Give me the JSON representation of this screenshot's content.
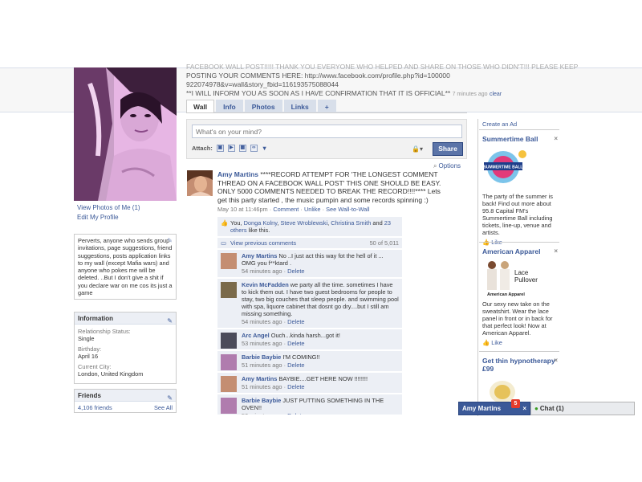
{
  "status": {
    "line1": "FACEBOOK WALL POST!!!!! THANK YOU EVERYONE WHO HELPED AND SHARE ON THOSE WHO DIDN'T!!!   PLEASE KEEP",
    "line2": "POSTING YOUR COMMENTS HERE: http://www.facebook.com/profile.php?id=100000",
    "line3": "922074978&v=wall&story_fbid=116193575088044",
    "line4": "**I WILL INFORM YOU AS SOON AS I HAVE CONFIRMATION THAT IT IS OFFICIAL**",
    "time": "7 minutes ago",
    "clear": "clear"
  },
  "profile": {
    "view_photos": "View Photos of Me (1)",
    "edit_profile": "Edit My Profile",
    "bio": "Perverts, anyone who sends group invitations, page suggestions, friend suggestions, posts application links to my wall (except Mafia wars) and anyone who pokes me will be deleted. ..But I don't give a shit if you declare war on me cos its just a game"
  },
  "info": {
    "title": "Information",
    "rel_label": "Relationship Status:",
    "rel_value": "Single",
    "bday_label": "Birthday:",
    "bday_value": "April 16",
    "city_label": "Current City:",
    "city_value": "London, United Kingdom"
  },
  "friends": {
    "title": "Friends",
    "count": "4,106 friends",
    "see_all": "See All"
  },
  "tabs": [
    "Wall",
    "Info",
    "Photos",
    "Links",
    "+"
  ],
  "composer": {
    "placeholder": "What's on your mind?",
    "attach": "Attach:",
    "share": "Share"
  },
  "options": "Options",
  "post": {
    "author": "Amy Martins",
    "text": " ****RECORD ATTEMPT FOR 'THE LONGEST COMMENT THREAD ON A FACEBOOK WALL POST' THIS ONE SHOULD BE EASY. ONLY 5000 COMMENTS NEEDED TO BREAK THE RECORD!!!!**** Lets get this party started , the music pumpin and some records spinning :)",
    "time": "May 10 at 11:46pm",
    "comment": "Comment",
    "unlike": "Unlike",
    "see_wall": "See Wall-to-Wall",
    "sep": "·"
  },
  "likes": {
    "you": "You,",
    "n1": "Donga Kolny",
    "n2": "Steve Wroblewski",
    "n3": "Christina Smith",
    "and": "and",
    "others": "23 others",
    "tail": "like this."
  },
  "viewprev": {
    "label": "View previous comments",
    "count": "50 of 5,011"
  },
  "comments": [
    {
      "name": "Amy Martins",
      "text": "No ..I just act this way fot the hell of it ... OMG you f**ktard .",
      "time": "54 minutes ago",
      "del": "Delete",
      "color": "#c48e72"
    },
    {
      "name": "Kevin McFadden",
      "text": "we party all the time. sometimes I have to kick them out. I have two guest bedrooms for people to stay, two big couches that sleep people. and swimming pool with spa, liquore cabinet that dosnt go dry....but I still am missing something.",
      "time": "54 minutes ago",
      "del": "Delete",
      "color": "#7a6a4a"
    },
    {
      "name": "Arc Angel",
      "text": "Ouch...kinda harsh...got it!",
      "time": "53 minutes ago",
      "del": "Delete",
      "color": "#4b4b5a"
    },
    {
      "name": "Barbie Baybie",
      "text": "I'M COMING!!",
      "time": "51 minutes ago",
      "del": "Delete",
      "color": "#b07cae"
    },
    {
      "name": "Amy Martins",
      "text": "BAYBIE....GET HERE NOW !!!!!!!!",
      "time": "51 minutes ago",
      "del": "Delete",
      "color": "#c48e72"
    },
    {
      "name": "Barbie Baybie",
      "text": "JUST PUTTING SOMETHING IN THE OVEN!!",
      "time": "50 minutes ago",
      "del": "Delete",
      "color": "#b07cae"
    }
  ],
  "ads": {
    "create": "Create an Ad",
    "ad1": {
      "title": "Summertime Ball",
      "text": "The party of the summer is back! Find out more about 95.8 Capital FM's Summertime Ball including tickets, line-up, venue and artists.",
      "like": "Like",
      "logo_text": "SUMMERTIME BALL"
    },
    "ad2": {
      "title": "American Apparel",
      "text": "Our sexy new take on the sweatshirt. Wear the lace panel in front or in back for that perfect look! Now at American Apparel.",
      "like": "Like",
      "img_line1": "Lace",
      "img_line2": "Pullover",
      "brand": "American Apparel"
    },
    "ad3": {
      "title": "Get thin hypnotherapy £99"
    }
  },
  "chat": {
    "name": "Amy Martins",
    "badge": "5",
    "bar": "Chat (1)"
  },
  "colors": {
    "fb_blue": "#3b5998",
    "light_blue": "#eceff5",
    "photo_tint": "#e9b8e6"
  }
}
